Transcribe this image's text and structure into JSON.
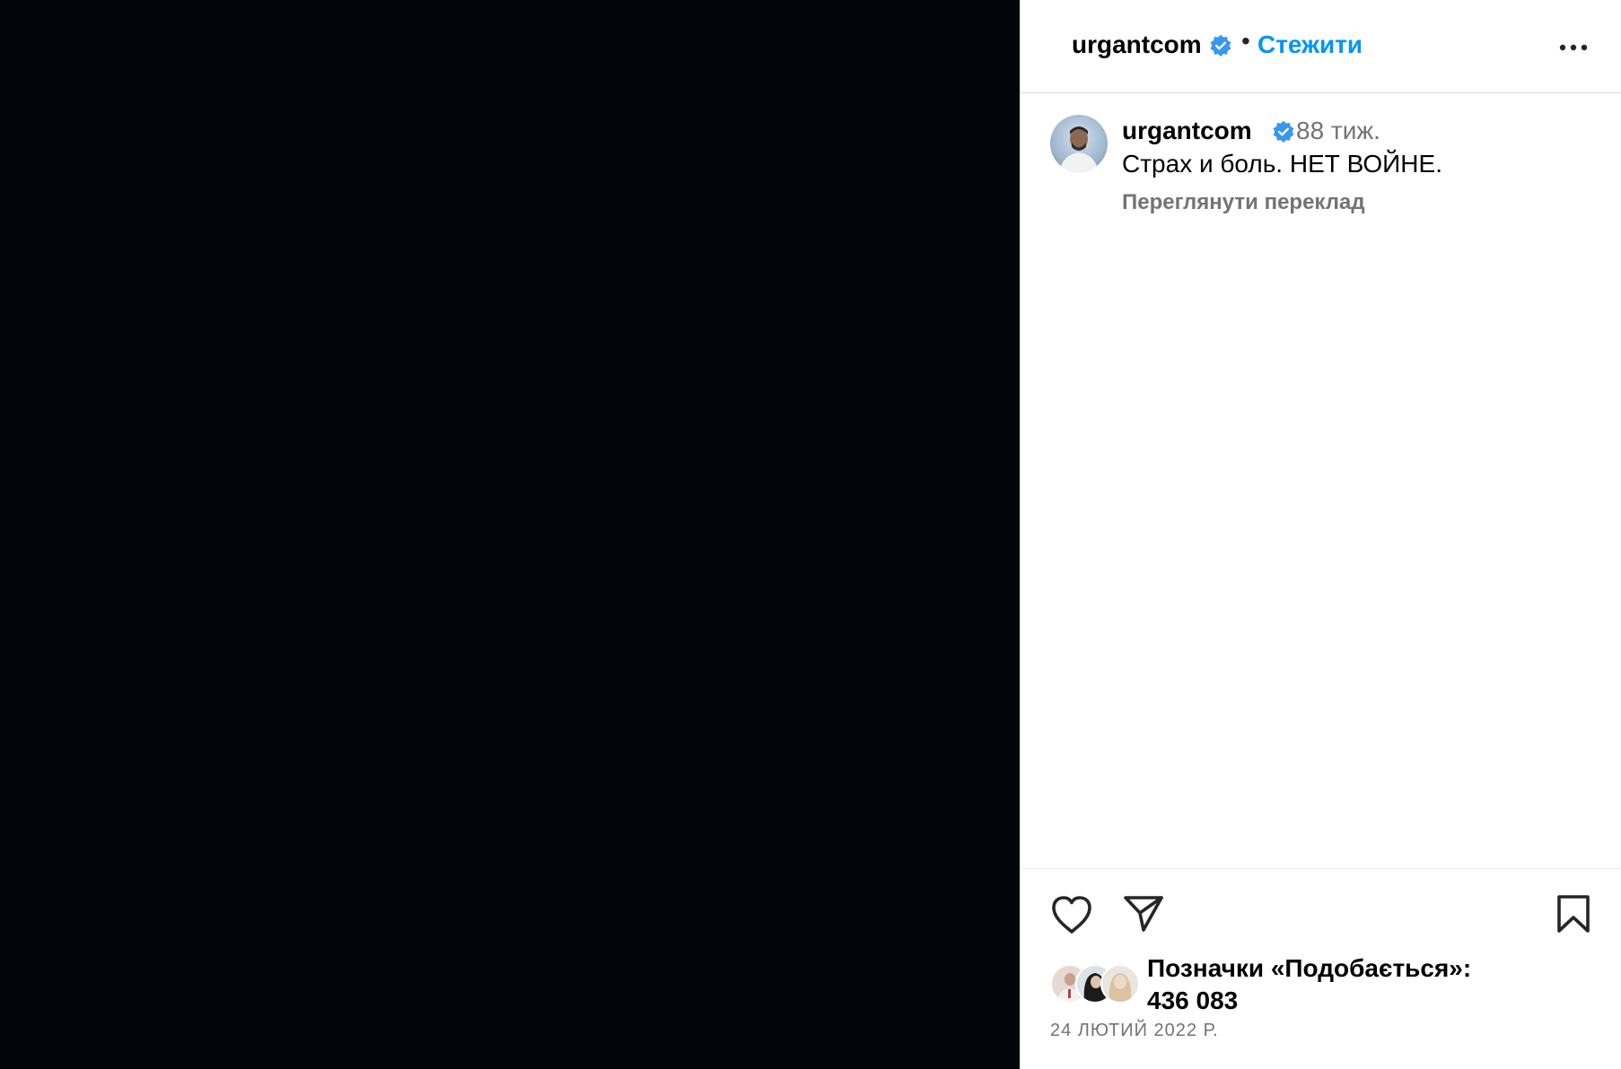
{
  "post": {
    "username": "urgantcom",
    "follow_label": "Стежити",
    "header_dot": "•",
    "time_ago": "88 тиж.",
    "caption": "Страх и боль. НЕТ ВОЙНЕ.",
    "translate_label": "Переглянути переклад",
    "likes_label": "Позначки «Подобається»:",
    "likes_count": "436 083",
    "date": "24 ЛЮТИЙ 2022 Р."
  },
  "icons": {
    "verified": "verified-badge-icon",
    "more": "more-options-icon",
    "like": "heart-icon",
    "share": "paper-plane-icon",
    "save": "bookmark-icon"
  },
  "colors": {
    "media_bg": "#04050a",
    "accent": "#0095f6",
    "verified": "#3897f0",
    "muted": "#737373"
  }
}
